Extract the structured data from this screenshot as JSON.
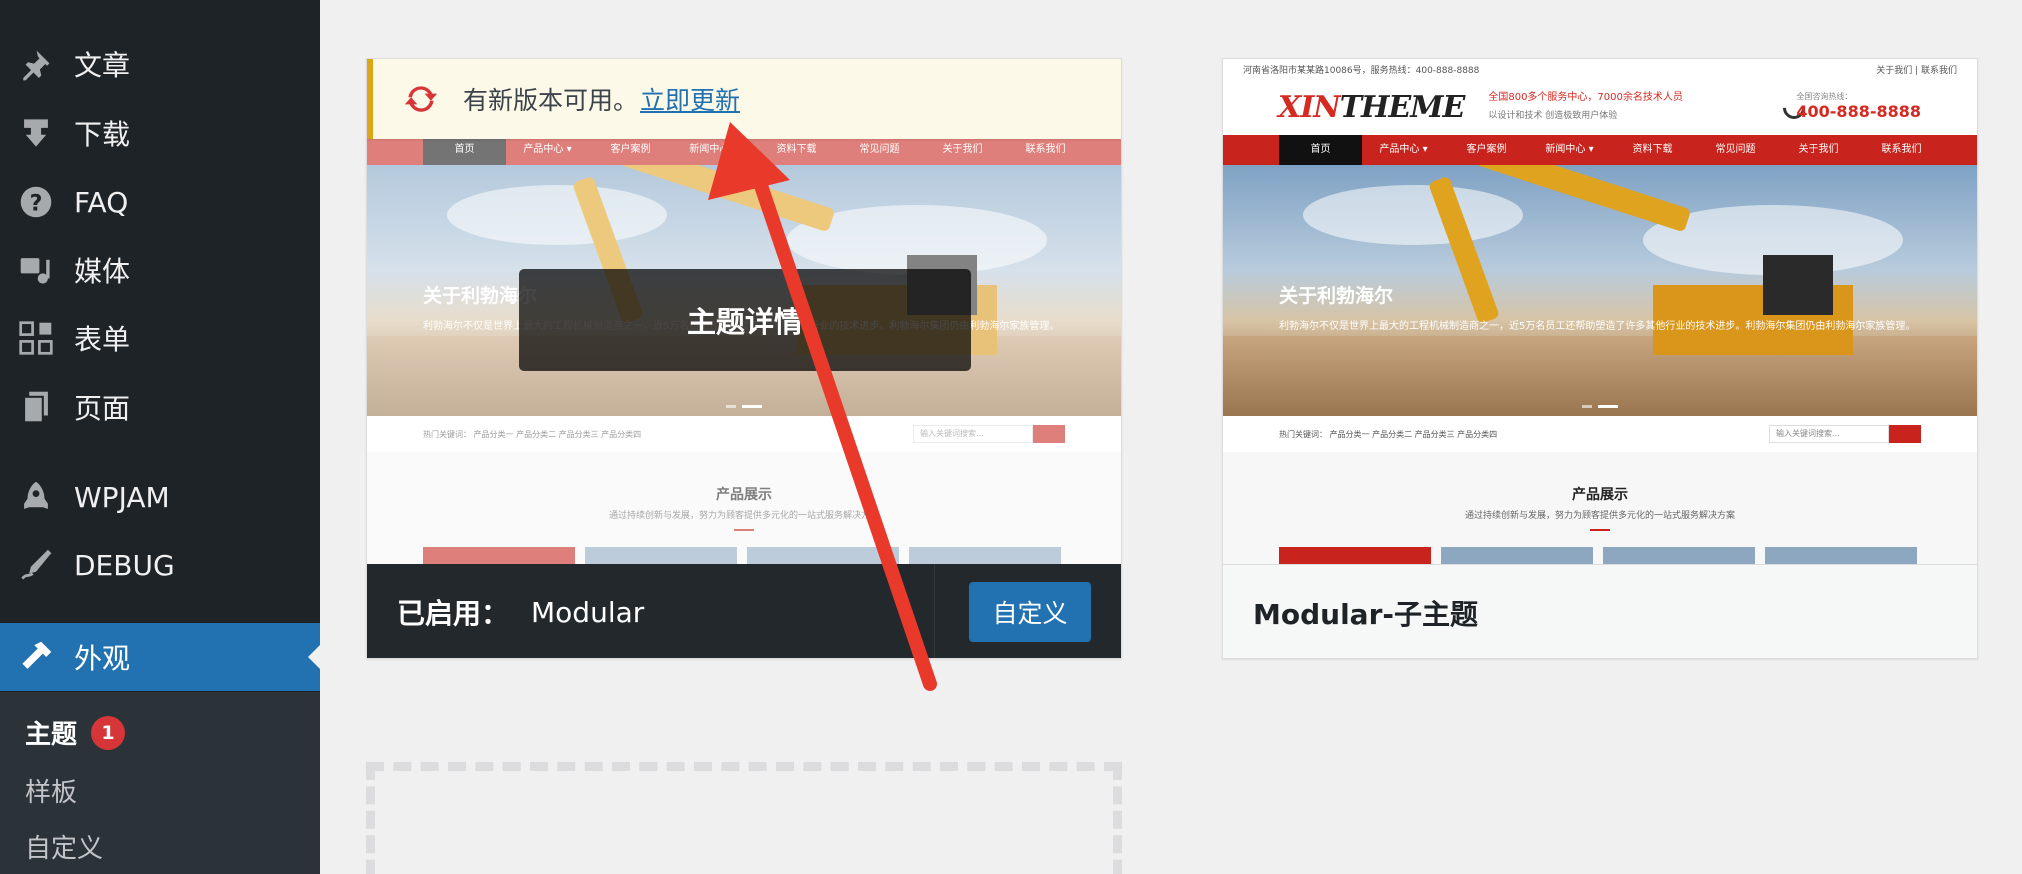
{
  "sidebar": {
    "items": [
      {
        "label": "文章",
        "icon": "pushpin-icon"
      },
      {
        "label": "下载",
        "icon": "download-icon"
      },
      {
        "label": "FAQ",
        "icon": "help-icon"
      },
      {
        "label": "媒体",
        "icon": "media-icon"
      },
      {
        "label": "表单",
        "icon": "forms-icon"
      },
      {
        "label": "页面",
        "icon": "pages-icon"
      },
      {
        "label": "WPJAM",
        "icon": "rocket-icon"
      },
      {
        "label": "DEBUG",
        "icon": "pen-icon"
      },
      {
        "label": "外观",
        "icon": "appearance-icon",
        "active": true
      }
    ],
    "submenu": {
      "themes": "主题",
      "themes_badge": "1",
      "patterns": "样板",
      "customize": "自定义"
    }
  },
  "active_theme": {
    "update_text": "有新版本可用。",
    "update_link": "立即更新",
    "details_label": "主题详情",
    "active_prefix": "已启用：",
    "name": "Modular",
    "customize_label": "自定义"
  },
  "child_theme": {
    "name": "Modular-子主题"
  },
  "preview": {
    "topbar_left": "河南省洛阳市某某路10086号，服务热线：400-888-8888",
    "topbar_right": "关于我们 | 联系我们",
    "logo_main": "XIN",
    "logo_rest": "THEME",
    "tagline": "全国800多个服务中心，7000余名技术人员",
    "tagline_sub": "以设计和技术 创造极致用户体验",
    "phone_label": "全国咨询热线：",
    "phone": "400-888-8888",
    "nav": [
      "首页",
      "产品中心 ▾",
      "客户案例",
      "新闻中心 ▾",
      "资料下载",
      "常见问题",
      "关于我们",
      "联系我们"
    ],
    "hero_title": "关于利勃海尔",
    "hero_text": "利勃海尔不仅是世界上最大的工程机械制造商之一，近5万名员工还帮助塑造了许多其他行业的技术进步。利勃海尔集团仍由利勃海尔家族管理。",
    "keywords": "热门关键词：   产品分类一    产品分类二    产品分类三    产品分类四",
    "search_placeholder": "输入关键词搜索...",
    "section_title": "产品展示",
    "section_sub": "通过持续创新与发展，努力为顾客提供多元化的一站式服务解决方案"
  },
  "colors": {
    "sidebar_bg": "#1d2327",
    "active_menu": "#2271b1",
    "badge": "#d63638",
    "update_border": "#dba617",
    "preview_red": "#c8241d",
    "arrow": "#e8392b"
  }
}
